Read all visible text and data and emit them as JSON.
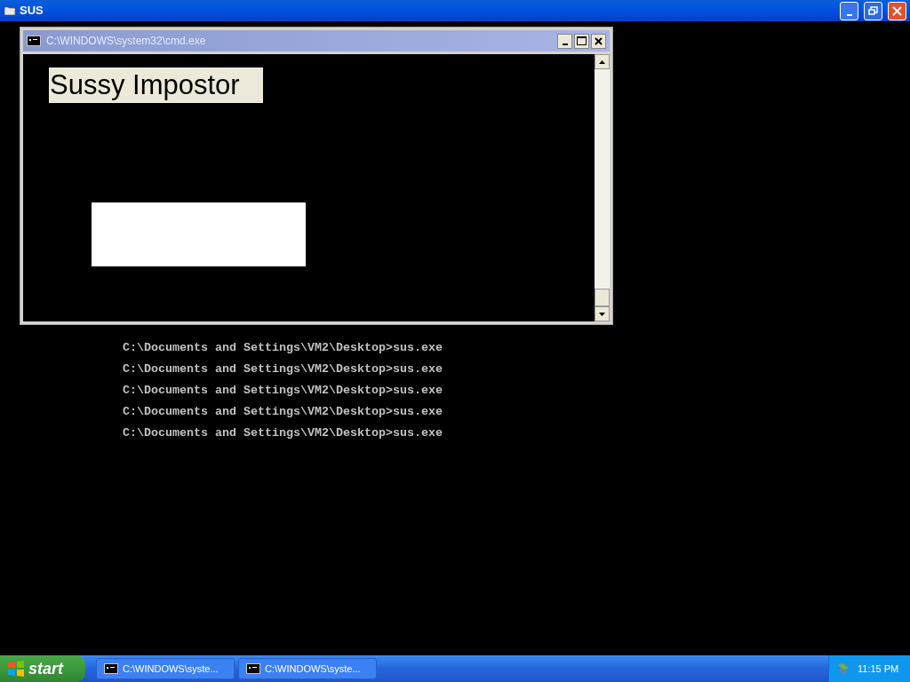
{
  "window": {
    "title": "SUS"
  },
  "console_lines": [
    "C:\\Documents and Settings\\VM2\\Desktop>sus.exe",
    "C:\\Documents and Settings\\VM2\\Desktop>sus.exe",
    "C:\\Documents and Settings\\VM2\\Desktop>sus.exe",
    "C:\\Documents and Settings\\VM2\\Desktop>sus.exe",
    "C:\\Documents and Settings\\VM2\\Desktop>sus.exe"
  ],
  "cmd_window": {
    "title": "C:\\WINDOWS\\system32\\cmd.exe",
    "label": "Sussy Impostor"
  },
  "taskbar": {
    "start": "start",
    "tasks": [
      "C:\\WINDOWS\\syste...",
      "C:\\WINDOWS\\syste..."
    ],
    "clock": "11:15 PM"
  }
}
